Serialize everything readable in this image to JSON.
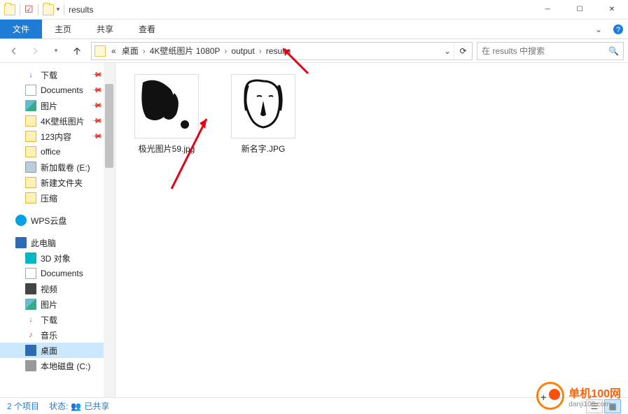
{
  "window": {
    "title": "results"
  },
  "ribbon": {
    "file": "文件",
    "tabs": [
      "主页",
      "共享",
      "查看"
    ]
  },
  "breadcrumb": {
    "lead": "«",
    "items": [
      "桌面",
      "4K壁纸图片 1080P",
      "output",
      "results"
    ]
  },
  "search": {
    "placeholder": "在 results 中搜索"
  },
  "tree": {
    "items": [
      {
        "icon": "dl",
        "label": "下载",
        "pin": true,
        "deep": true
      },
      {
        "icon": "doc",
        "label": "Documents",
        "pin": true,
        "deep": true
      },
      {
        "icon": "img",
        "label": "图片",
        "pin": true,
        "deep": true
      },
      {
        "icon": "folder",
        "label": "4K壁纸图片",
        "pin": true,
        "deep": true
      },
      {
        "icon": "folder",
        "label": "123内容",
        "pin": true,
        "deep": true
      },
      {
        "icon": "folder",
        "label": "office",
        "deep": true
      },
      {
        "icon": "drive",
        "label": "新加载卷 (E:)",
        "deep": true
      },
      {
        "icon": "folder",
        "label": "新建文件夹",
        "deep": true
      },
      {
        "icon": "folder",
        "label": "压缩",
        "deep": true
      },
      {
        "gap": true
      },
      {
        "icon": "wps",
        "label": "WPS云盘",
        "deep": false
      },
      {
        "gap": true
      },
      {
        "icon": "pc",
        "label": "此电脑",
        "deep": false
      },
      {
        "icon": "cube",
        "label": "3D 对象",
        "deep": true
      },
      {
        "icon": "doc",
        "label": "Documents",
        "deep": true
      },
      {
        "icon": "vid",
        "label": "视频",
        "deep": true
      },
      {
        "icon": "img",
        "label": "图片",
        "deep": true
      },
      {
        "icon": "dl",
        "label": "下载",
        "deep": true
      },
      {
        "icon": "music",
        "label": "音乐",
        "deep": true
      },
      {
        "icon": "desk",
        "label": "桌面",
        "deep": true,
        "selected": true
      },
      {
        "icon": "ldrive",
        "label": "本地磁盘 (C:)",
        "deep": true
      }
    ]
  },
  "files": [
    {
      "name": "极光图片59.jpg"
    },
    {
      "name": "新名字.JPG"
    }
  ],
  "status": {
    "count": "2 个项目",
    "state_label": "状态:",
    "state_value": "已共享"
  },
  "watermark": {
    "brand": "单机100网",
    "url": "danji100.com"
  }
}
